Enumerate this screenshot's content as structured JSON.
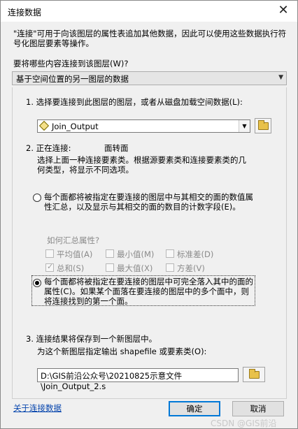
{
  "window": {
    "title": "连接数据",
    "close_glyph": "✕"
  },
  "description": "\"连接\"可用于向该图层的属性表追加其他数据，因此可以使用这些数据执行符号化图层要素等操作。",
  "join_type": {
    "label": "要将哪些内容连接到该图层(W)?",
    "value": "基于空间位置的另一图层的数据"
  },
  "step1": {
    "label": "1. 选择要连接到此图层的图层，或者从磁盘加载空间数据(L):",
    "layer_value": "Join_Output",
    "layer_icon": "polygon-layer-icon"
  },
  "step2": {
    "label": "2. 正在连接:",
    "geometry": "面转面",
    "info": "选择上面一种连接要素类。根据源要素类和连接要素类的几何类型，将显示不同选项。",
    "option_summarize": "每个面都将被指定在要连接的图层中与其相交的面的数值属性汇总，以及显示与其相交的面的数目的计数字段(E)。",
    "summary_heading": "如何汇总属性?",
    "checkboxes": [
      {
        "label": "平均值(A)",
        "checked": false
      },
      {
        "label": "最小值(M)",
        "checked": false
      },
      {
        "label": "标准差(D)",
        "checked": false
      },
      {
        "label": "总和(S)",
        "checked": true
      },
      {
        "label": "最大值(X)",
        "checked": false
      },
      {
        "label": "方差(V)",
        "checked": false
      }
    ],
    "option_contained": "每个面都将被指定在要连接的图层中可完全落入其中的面的属性(C)。如果某个面落在要连接的图层中的多个面中，则将连接找到的第一个面。",
    "selected_option": "contained"
  },
  "step3": {
    "label": "3. 连接结果将保存到一个新图层中。",
    "sublabel": "为这个新图层指定输出 shapefile 或要素类(O):",
    "output_path": "D:\\GIS前沿公众号\\20210825示意文件\\Join_Output_2.s"
  },
  "footer": {
    "help_link": "关于连接数据",
    "ok_label": "确定",
    "cancel_label": "取消",
    "watermark": "CSDN @GIS前沿"
  },
  "colors": {
    "accent": "#0078d7",
    "link": "#0645ad",
    "dialog_bg": "#f0f0f0"
  }
}
